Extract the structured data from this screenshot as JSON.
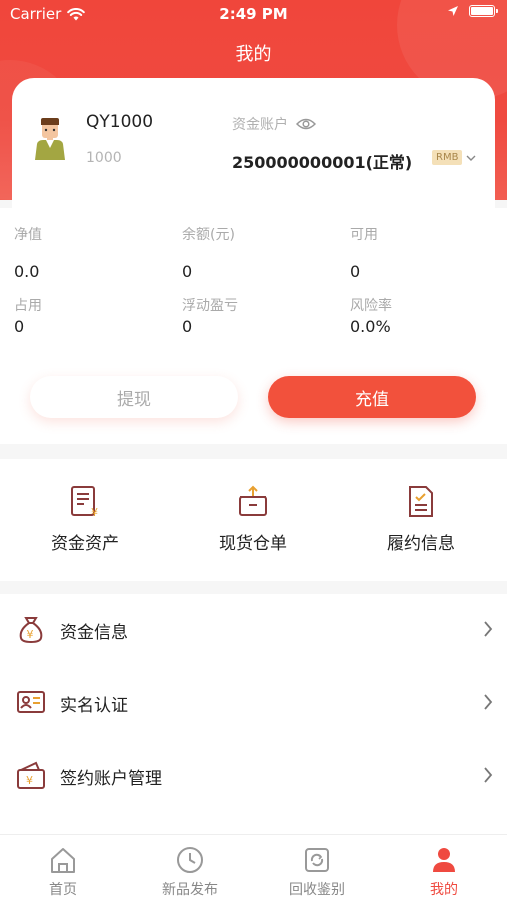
{
  "status_bar": {
    "carrier": "Carrier",
    "time": "2:49 PM"
  },
  "page_title": "我的",
  "account": {
    "username": "QY1000",
    "user_id": "1000",
    "fund_label": "资金账户",
    "fund_number": "250000000001(正常)",
    "currency": "RMB"
  },
  "stats": [
    {
      "label": "净值",
      "value": "0.0"
    },
    {
      "label": "余额(元)",
      "value": "0"
    },
    {
      "label": "可用",
      "value": "0"
    },
    {
      "label": "占用",
      "value": "0"
    },
    {
      "label": "浮动盈亏",
      "value": "0"
    },
    {
      "label": "风险率",
      "value": "0.0%"
    }
  ],
  "buttons": {
    "withdraw": "提现",
    "recharge": "充值"
  },
  "quick_actions": [
    {
      "label": "资金资产",
      "icon": "document-yen-icon"
    },
    {
      "label": "现货仓单",
      "icon": "box-icon"
    },
    {
      "label": "履约信息",
      "icon": "contract-icon"
    }
  ],
  "menu": [
    {
      "label": "资金信息",
      "icon": "money-bag-icon"
    },
    {
      "label": "实名认证",
      "icon": "id-card-icon"
    },
    {
      "label": "签约账户管理",
      "icon": "wallet-icon"
    }
  ],
  "tabs": [
    {
      "label": "首页",
      "icon": "home-icon"
    },
    {
      "label": "新品发布",
      "icon": "clock-icon"
    },
    {
      "label": "回收鉴别",
      "icon": "recycle-icon"
    },
    {
      "label": "我的",
      "icon": "person-icon",
      "active": true
    }
  ],
  "colors": {
    "brand": "#ef4a40",
    "recharge": "#f2513c",
    "icon_stroke": "#a06060"
  }
}
